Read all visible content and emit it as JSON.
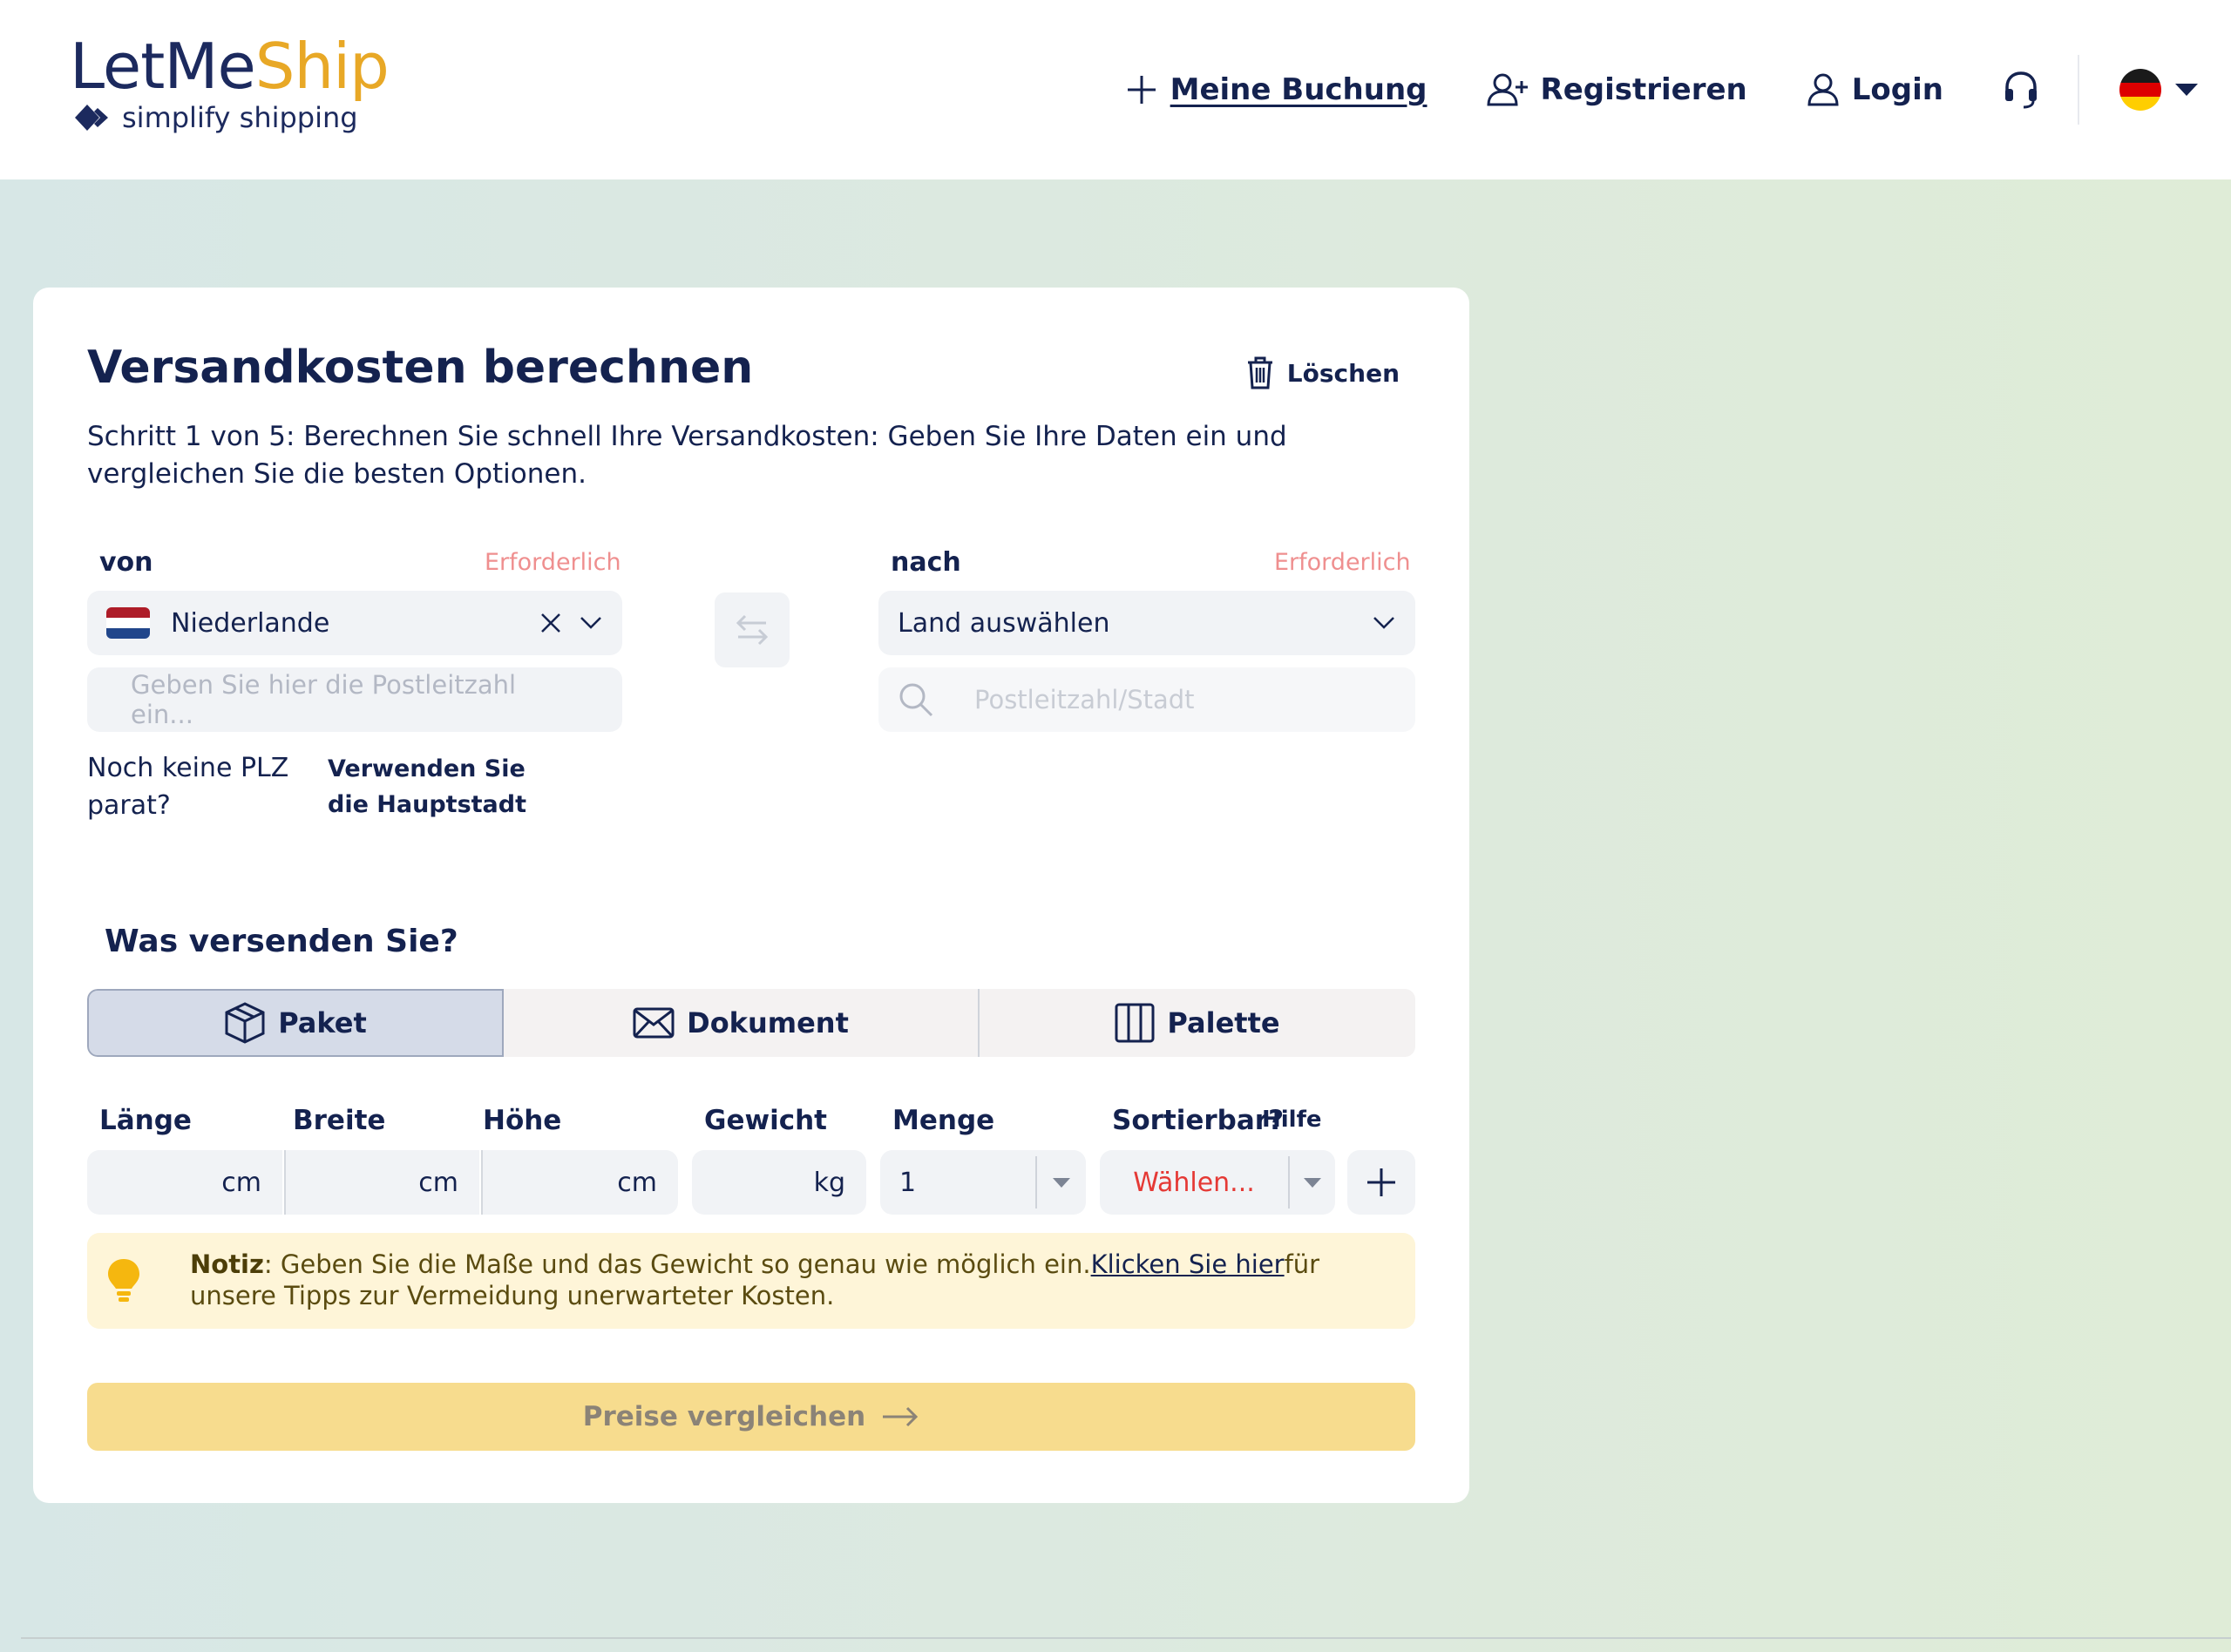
{
  "header": {
    "logo": {
      "part1": "LetMe",
      "part2": "Ship",
      "tagline": "simplify shipping"
    },
    "nav": {
      "booking": "Meine Buchung",
      "register": "Registrieren",
      "login": "Login"
    },
    "colors": {
      "brand": "#1c2a5e",
      "accent": "#e8a826"
    }
  },
  "form": {
    "title": "Versandkosten berechnen",
    "clear_label": "Löschen",
    "subtitle": "Schritt 1 von 5: Berechnen Sie schnell Ihre Versandkosten: Geben Sie Ihre Daten ein und vergleichen Sie die besten Optionen.",
    "from": {
      "label": "von",
      "required": "Erforderlich",
      "country": "Niederlande",
      "postal_placeholder": "Geben Sie hier die Postleitzahl ein..."
    },
    "to": {
      "label": "nach",
      "required": "Erforderlich",
      "country_placeholder": "Land auswählen",
      "postal_placeholder": "Postleitzahl/Stadt"
    },
    "no_postal": "Noch keine PLZ parat?",
    "use_capital": "Verwenden Sie die Hauptstadt",
    "section_title": "Was versenden Sie?",
    "tabs": [
      {
        "label": "Paket",
        "icon": "box-icon",
        "active": true
      },
      {
        "label": "Dokument",
        "icon": "envelope-icon",
        "active": false
      },
      {
        "label": "Palette",
        "icon": "pallet-icon",
        "active": false
      }
    ],
    "dims": {
      "length_label": "Länge",
      "width_label": "Breite",
      "height_label": "Höhe",
      "weight_label": "Gewicht",
      "qty_label": "Menge",
      "sortable_label": "Sortierbar?",
      "help_label": "Hilfe",
      "unit_cm": "cm",
      "unit_kg": "kg",
      "qty_value": "1",
      "sortable_value": "Wählen..."
    },
    "note": {
      "bold": "Notiz",
      "text1": ": Geben Sie die Maße und das Gewicht so genau wie möglich ein.",
      "link": "Klicken Sie hier",
      "text2": "für unsere Tipps zur Vermeidung unerwarteter Kosten."
    },
    "compare_label": "Preise vergleichen"
  }
}
